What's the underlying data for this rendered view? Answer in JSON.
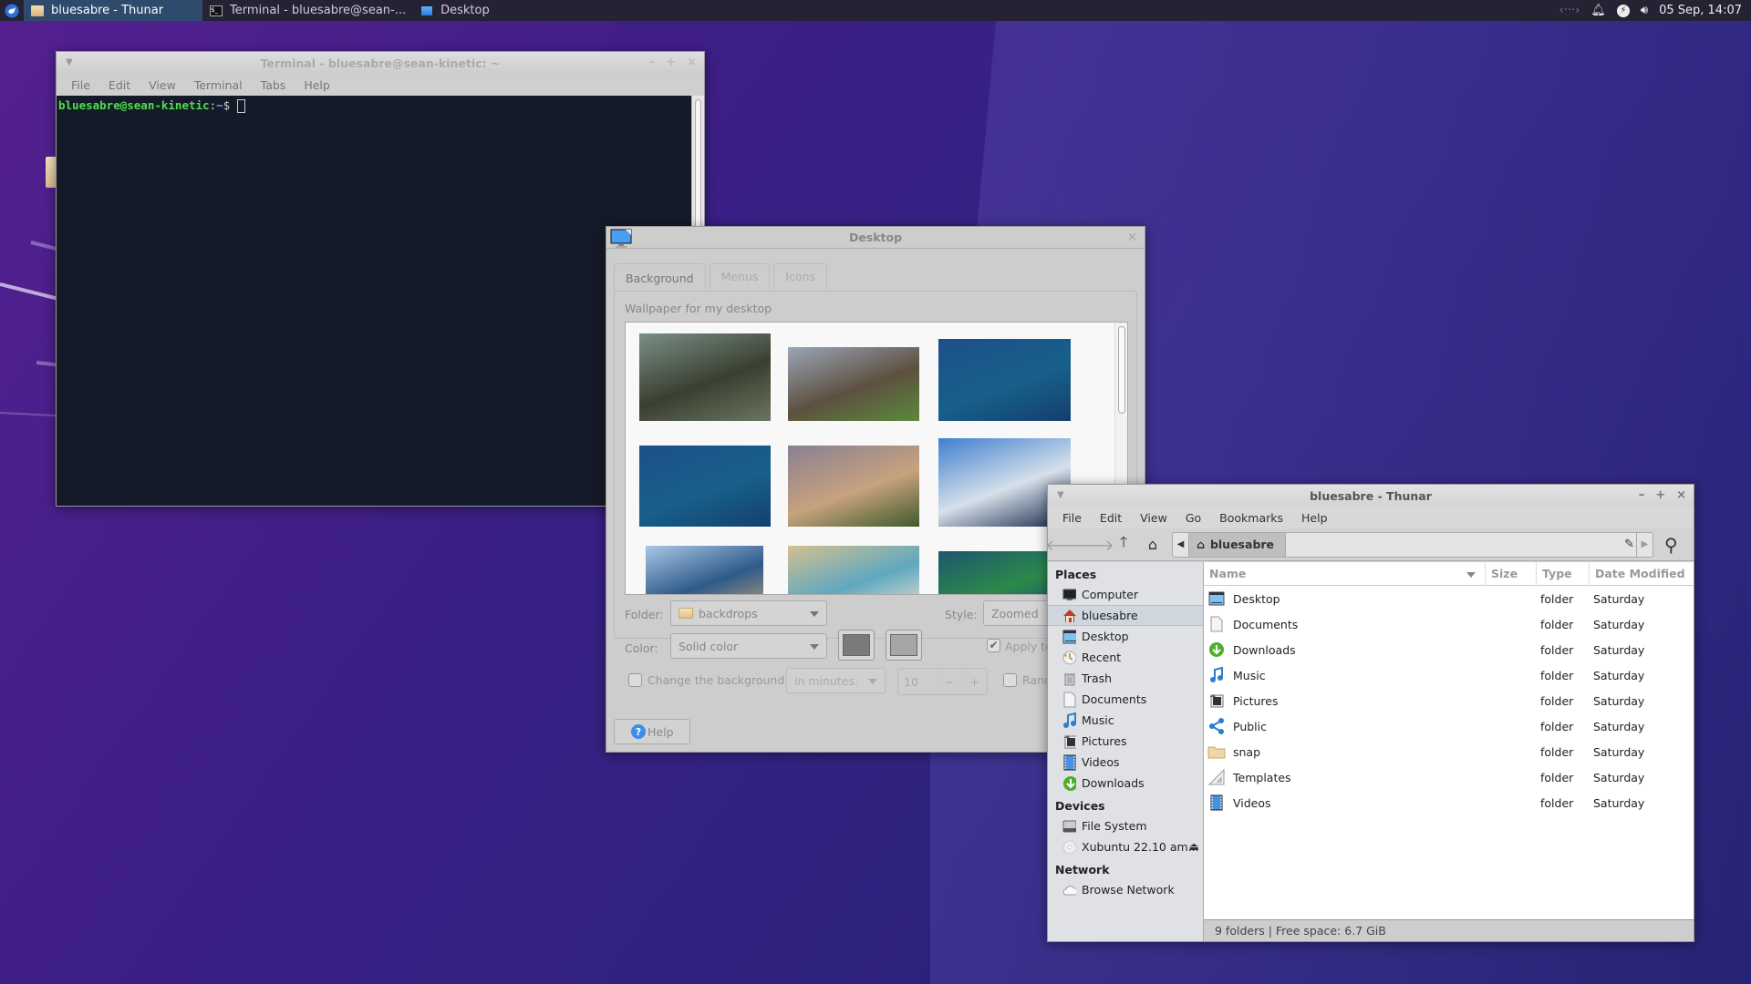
{
  "taskbar": {
    "tasks": [
      {
        "label": "bluesabre - Thunar",
        "icon": "folder-icon",
        "active": true
      },
      {
        "label": "Terminal - bluesabre@sean-...",
        "icon": "terminal-icon",
        "active": false
      },
      {
        "label": "Desktop",
        "icon": "monitor-icon",
        "active": false
      }
    ],
    "clock": "05 Sep, 14:07",
    "tray_icons": [
      "network-arrows-icon",
      "bell-icon",
      "power-icon",
      "volume-icon"
    ]
  },
  "terminal": {
    "title": "Terminal - bluesabre@sean-kinetic: ~",
    "menu": [
      "File",
      "Edit",
      "View",
      "Terminal",
      "Tabs",
      "Help"
    ],
    "prompt_user": "bluesabre@sean-kinetic",
    "prompt_sep": ":",
    "prompt_path": "~",
    "prompt_symbol": "$"
  },
  "desktop_dialog": {
    "title": "Desktop",
    "tabs": [
      {
        "label": "Background",
        "active": true
      },
      {
        "label": "Menus",
        "active": false
      },
      {
        "label": "Icons",
        "active": false
      }
    ],
    "subheading": "Wallpaper for my desktop",
    "wallpapers": [
      {
        "name": "rocky-cliffs",
        "colors": [
          "#7a8f88",
          "#3a4030",
          "#6a7560"
        ]
      },
      {
        "name": "plowed-field-clouds",
        "colors": [
          "#9aa6b8",
          "#5e5040",
          "#5a8a3a"
        ]
      },
      {
        "name": "xubuntu-blue-teal",
        "colors": [
          "#1e4f8a",
          "#17608a",
          "#143f6e"
        ]
      },
      {
        "name": "xubuntu-blue-teal-2",
        "colors": [
          "#1e4f8a",
          "#17608a",
          "#143f6e"
        ]
      },
      {
        "name": "hills-sunset-painting",
        "colors": [
          "#8a8092",
          "#c7a27e",
          "#3e5a2a"
        ]
      },
      {
        "name": "snowy-mountains",
        "colors": [
          "#3f7fd0",
          "#d6e0ea",
          "#15284a"
        ]
      },
      {
        "name": "sea-arch",
        "colors": [
          "#aac8e6",
          "#2e5a8a",
          "#b7a07a"
        ]
      },
      {
        "name": "coastline-aerial",
        "colors": [
          "#d2c090",
          "#5fa8c0",
          "#e8e0d0"
        ]
      },
      {
        "name": "xubuntu-green-teal",
        "colors": [
          "#1f5570",
          "#2a8a4a",
          "#1a4a7a"
        ]
      }
    ],
    "folder_label": "Folder:",
    "folder_value": "backdrops",
    "style_label": "Style:",
    "style_value": "Zoomed",
    "color_label": "Color:",
    "color_value": "Solid color",
    "color_primary": "#7a7a7a",
    "color_secondary": "#a6a6a6",
    "apply_label": "Apply to",
    "apply_checked": true,
    "change_bg_label": "Change the background",
    "change_bg_checked": false,
    "interval_unit": "in minutes:",
    "interval_value": "10",
    "random_label": "Rand",
    "random_checked": false,
    "help_label": "Help"
  },
  "thunar": {
    "title": "bluesabre - Thunar",
    "menu": [
      "File",
      "Edit",
      "View",
      "Go",
      "Bookmarks",
      "Help"
    ],
    "path_crumb": "bluesabre",
    "sidebar": {
      "sections": [
        {
          "heading": "Places",
          "items": [
            {
              "label": "Computer",
              "icon": "computer-icon",
              "selected": false
            },
            {
              "label": "bluesabre",
              "icon": "home-icon",
              "selected": true
            },
            {
              "label": "Desktop",
              "icon": "desktop-icon",
              "selected": false
            },
            {
              "label": "Recent",
              "icon": "recent-icon",
              "selected": false
            },
            {
              "label": "Trash",
              "icon": "trash-icon",
              "selected": false
            },
            {
              "label": "Documents",
              "icon": "document-icon",
              "selected": false
            },
            {
              "label": "Music",
              "icon": "music-icon",
              "selected": false
            },
            {
              "label": "Pictures",
              "icon": "pictures-icon",
              "selected": false
            },
            {
              "label": "Videos",
              "icon": "videos-icon",
              "selected": false
            },
            {
              "label": "Downloads",
              "icon": "downloads-icon",
              "selected": false
            }
          ]
        },
        {
          "heading": "Devices",
          "items": [
            {
              "label": "File System",
              "icon": "harddisk-icon",
              "selected": false
            },
            {
              "label": "Xubuntu 22.10 am...",
              "icon": "optical-disc-icon",
              "selected": false,
              "eject": true
            }
          ]
        },
        {
          "heading": "Network",
          "items": [
            {
              "label": "Browse Network",
              "icon": "network-cloud-icon",
              "selected": false
            }
          ]
        }
      ]
    },
    "columns": [
      "Name",
      "Size",
      "Type",
      "Date Modified"
    ],
    "files": [
      {
        "name": "Desktop",
        "size": "",
        "type": "folder",
        "modified": "Saturday",
        "icon": "desktop-icon"
      },
      {
        "name": "Documents",
        "size": "",
        "type": "folder",
        "modified": "Saturday",
        "icon": "document-icon"
      },
      {
        "name": "Downloads",
        "size": "",
        "type": "folder",
        "modified": "Saturday",
        "icon": "downloads-icon"
      },
      {
        "name": "Music",
        "size": "",
        "type": "folder",
        "modified": "Saturday",
        "icon": "music-icon"
      },
      {
        "name": "Pictures",
        "size": "",
        "type": "folder",
        "modified": "Saturday",
        "icon": "pictures-icon"
      },
      {
        "name": "Public",
        "size": "",
        "type": "folder",
        "modified": "Saturday",
        "icon": "share-icon"
      },
      {
        "name": "snap",
        "size": "",
        "type": "folder",
        "modified": "Saturday",
        "icon": "folder-icon"
      },
      {
        "name": "Templates",
        "size": "",
        "type": "folder",
        "modified": "Saturday",
        "icon": "templates-icon"
      },
      {
        "name": "Videos",
        "size": "",
        "type": "folder",
        "modified": "Saturday",
        "icon": "videos-icon"
      }
    ],
    "status": "9 folders | Free space: 6.7 GiB"
  }
}
